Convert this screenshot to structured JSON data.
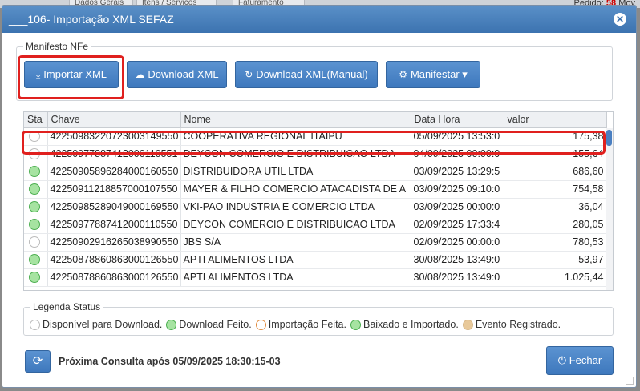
{
  "background": {
    "tabs": [
      "Dados Gerais",
      "Itens / Serviços",
      "Faturamento"
    ],
    "pedido_label": "Pedido:",
    "pedido_value": "58",
    "pedido_suffix": "Mov"
  },
  "dialog": {
    "title": "___106- Importação XML SEFAZ",
    "close_icon": "close-icon"
  },
  "manifesto": {
    "legend": "Manifesto NFe",
    "buttons": [
      {
        "label": "Importar XML",
        "icon": "download-tray-icon"
      },
      {
        "label": "Download XML",
        "icon": "cloud-download-icon"
      },
      {
        "label": "Download XML(Manual)",
        "icon": "refresh-icon"
      },
      {
        "label": "Manifestar",
        "icon": "gear-icon"
      }
    ]
  },
  "grid": {
    "columns": [
      "Sta",
      "Chave",
      "Nome",
      "Data Hora",
      "valor"
    ],
    "rows": [
      {
        "status": "empty",
        "chave": "42250983220723003149550",
        "nome": "COOPERATIVA REGIONAL ITAIPU",
        "data": "05/09/2025 13:53:0",
        "valor": "175,38"
      },
      {
        "status": "empty",
        "chave": "42250977887412000110551",
        "nome": "DEYCON COMERCIO E DISTRIBUICAO LTDA",
        "data": "04/09/2025 00:00:0",
        "valor": "155,64"
      },
      {
        "status": "green",
        "chave": "42250905896284000160550",
        "nome": "DISTRIBUIDORA UTIL LTDA",
        "data": "03/09/2025 13:29:5",
        "valor": "686,60"
      },
      {
        "status": "green",
        "chave": "42250911218857000107550",
        "nome": "MAYER & FILHO COMERCIO ATACADISTA DE A",
        "data": "03/09/2025 09:10:0",
        "valor": "754,58"
      },
      {
        "status": "green",
        "chave": "42250985289049000169550",
        "nome": "VKI-PAO INDUSTRIA E COMERCIO LTDA",
        "data": "03/09/2025 00:00:0",
        "valor": "36,04"
      },
      {
        "status": "green",
        "chave": "42250977887412000110550",
        "nome": "DEYCON COMERCIO E DISTRIBUICAO LTDA",
        "data": "02/09/2025 17:33:4",
        "valor": "280,05"
      },
      {
        "status": "empty",
        "chave": "42250902916265038990550",
        "nome": "JBS S/A",
        "data": "02/09/2025 00:00:0",
        "valor": "780,53"
      },
      {
        "status": "green",
        "chave": "42250878860863000126550",
        "nome": "APTI ALIMENTOS LTDA",
        "data": "30/08/2025 13:49:0",
        "valor": "53,97"
      },
      {
        "status": "green",
        "chave": "42250878860863000126550",
        "nome": "APTI ALIMENTOS LTDA",
        "data": "30/08/2025 13:49:0",
        "valor": "1.025,44"
      }
    ]
  },
  "legenda": {
    "title": "Legenda Status",
    "items": [
      {
        "label": "Disponível para Download.",
        "color": "empty"
      },
      {
        "label": "Download Feito.",
        "color": "green"
      },
      {
        "label": "Importação Feita.",
        "color": "orange"
      },
      {
        "label": "Baixado e Importado.",
        "color": "green"
      },
      {
        "label": "Evento Registrado.",
        "color": "tan"
      }
    ]
  },
  "footer": {
    "next_query": "Próxima Consulta após 05/09/2025 18:30:15-03",
    "close_label": "Fechar"
  },
  "colors": {
    "accent": "#3e78bd",
    "highlight": "#e0201e"
  }
}
